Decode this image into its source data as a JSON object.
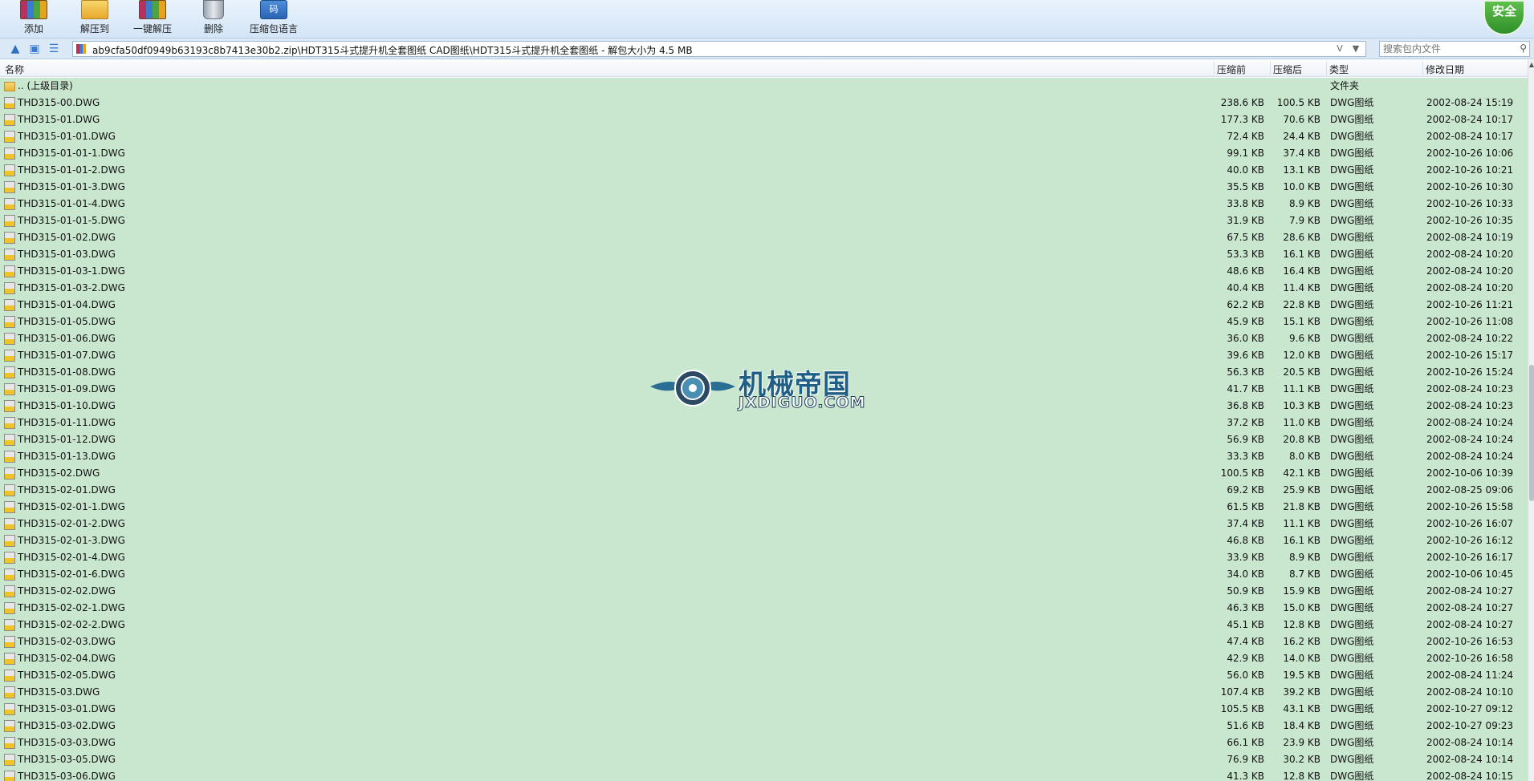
{
  "toolbar": {
    "buttons": [
      {
        "label": "添加",
        "icon": "add-archive-icon"
      },
      {
        "label": "解压到",
        "icon": "extract-to-icon"
      },
      {
        "label": "一键解压",
        "icon": "one-click-extract-icon"
      },
      {
        "label": "删除",
        "icon": "delete-icon"
      },
      {
        "label": "压缩包语言",
        "icon": "archive-language-icon"
      }
    ],
    "lang_icon_text": "码",
    "security_badge": "安全"
  },
  "address": {
    "path": "ab9cfa50df0949b63193c8b7413e30b2.zip\\HDT315斗式提升机全套图纸 CAD图纸\\HDT315斗式提升机全套图纸 - 解包大小为 4.5 MB",
    "dropdown_glyph": "V",
    "search_placeholder": "搜索包内文件"
  },
  "columns": {
    "name": "名称",
    "size": "压缩前",
    "packed": "压缩后",
    "type": "类型",
    "date": "修改日期"
  },
  "parent_row": {
    "name": ".. (上级目录)",
    "type": "文件夹"
  },
  "files": [
    {
      "name": "THD315-00.DWG",
      "size": "238.6 KB",
      "packed": "100.5 KB",
      "type": "DWG图纸",
      "date": "2002-08-24 15:19"
    },
    {
      "name": "THD315-01.DWG",
      "size": "177.3 KB",
      "packed": "70.6 KB",
      "type": "DWG图纸",
      "date": "2002-08-24 10:17"
    },
    {
      "name": "THD315-01-01.DWG",
      "size": "72.4 KB",
      "packed": "24.4 KB",
      "type": "DWG图纸",
      "date": "2002-08-24 10:17"
    },
    {
      "name": "THD315-01-01-1.DWG",
      "size": "99.1 KB",
      "packed": "37.4 KB",
      "type": "DWG图纸",
      "date": "2002-10-26 10:06"
    },
    {
      "name": "THD315-01-01-2.DWG",
      "size": "40.0 KB",
      "packed": "13.1 KB",
      "type": "DWG图纸",
      "date": "2002-10-26 10:21"
    },
    {
      "name": "THD315-01-01-3.DWG",
      "size": "35.5 KB",
      "packed": "10.0 KB",
      "type": "DWG图纸",
      "date": "2002-10-26 10:30"
    },
    {
      "name": "THD315-01-01-4.DWG",
      "size": "33.8 KB",
      "packed": "8.9 KB",
      "type": "DWG图纸",
      "date": "2002-10-26 10:33"
    },
    {
      "name": "THD315-01-01-5.DWG",
      "size": "31.9 KB",
      "packed": "7.9 KB",
      "type": "DWG图纸",
      "date": "2002-10-26 10:35"
    },
    {
      "name": "THD315-01-02.DWG",
      "size": "67.5 KB",
      "packed": "28.6 KB",
      "type": "DWG图纸",
      "date": "2002-08-24 10:19"
    },
    {
      "name": "THD315-01-03.DWG",
      "size": "53.3 KB",
      "packed": "16.1 KB",
      "type": "DWG图纸",
      "date": "2002-08-24 10:20"
    },
    {
      "name": "THD315-01-03-1.DWG",
      "size": "48.6 KB",
      "packed": "16.4 KB",
      "type": "DWG图纸",
      "date": "2002-08-24 10:20"
    },
    {
      "name": "THD315-01-03-2.DWG",
      "size": "40.4 KB",
      "packed": "11.4 KB",
      "type": "DWG图纸",
      "date": "2002-08-24 10:20"
    },
    {
      "name": "THD315-01-04.DWG",
      "size": "62.2 KB",
      "packed": "22.8 KB",
      "type": "DWG图纸",
      "date": "2002-10-26 11:21"
    },
    {
      "name": "THD315-01-05.DWG",
      "size": "45.9 KB",
      "packed": "15.1 KB",
      "type": "DWG图纸",
      "date": "2002-10-26 11:08"
    },
    {
      "name": "THD315-01-06.DWG",
      "size": "36.0 KB",
      "packed": "9.6 KB",
      "type": "DWG图纸",
      "date": "2002-08-24 10:22"
    },
    {
      "name": "THD315-01-07.DWG",
      "size": "39.6 KB",
      "packed": "12.0 KB",
      "type": "DWG图纸",
      "date": "2002-10-26 15:17"
    },
    {
      "name": "THD315-01-08.DWG",
      "size": "56.3 KB",
      "packed": "20.5 KB",
      "type": "DWG图纸",
      "date": "2002-10-26 15:24"
    },
    {
      "name": "THD315-01-09.DWG",
      "size": "41.7 KB",
      "packed": "11.1 KB",
      "type": "DWG图纸",
      "date": "2002-08-24 10:23"
    },
    {
      "name": "THD315-01-10.DWG",
      "size": "36.8 KB",
      "packed": "10.3 KB",
      "type": "DWG图纸",
      "date": "2002-08-24 10:23"
    },
    {
      "name": "THD315-01-11.DWG",
      "size": "37.2 KB",
      "packed": "11.0 KB",
      "type": "DWG图纸",
      "date": "2002-08-24 10:24"
    },
    {
      "name": "THD315-01-12.DWG",
      "size": "56.9 KB",
      "packed": "20.8 KB",
      "type": "DWG图纸",
      "date": "2002-08-24 10:24"
    },
    {
      "name": "THD315-01-13.DWG",
      "size": "33.3 KB",
      "packed": "8.0 KB",
      "type": "DWG图纸",
      "date": "2002-08-24 10:24"
    },
    {
      "name": "THD315-02.DWG",
      "size": "100.5 KB",
      "packed": "42.1 KB",
      "type": "DWG图纸",
      "date": "2002-10-06 10:39"
    },
    {
      "name": "THD315-02-01.DWG",
      "size": "69.2 KB",
      "packed": "25.9 KB",
      "type": "DWG图纸",
      "date": "2002-08-25 09:06"
    },
    {
      "name": "THD315-02-01-1.DWG",
      "size": "61.5 KB",
      "packed": "21.8 KB",
      "type": "DWG图纸",
      "date": "2002-10-26 15:58"
    },
    {
      "name": "THD315-02-01-2.DWG",
      "size": "37.4 KB",
      "packed": "11.1 KB",
      "type": "DWG图纸",
      "date": "2002-10-26 16:07"
    },
    {
      "name": "THD315-02-01-3.DWG",
      "size": "46.8 KB",
      "packed": "16.1 KB",
      "type": "DWG图纸",
      "date": "2002-10-26 16:12"
    },
    {
      "name": "THD315-02-01-4.DWG",
      "size": "33.9 KB",
      "packed": "8.9 KB",
      "type": "DWG图纸",
      "date": "2002-10-26 16:17"
    },
    {
      "name": "THD315-02-01-6.DWG",
      "size": "34.0 KB",
      "packed": "8.7 KB",
      "type": "DWG图纸",
      "date": "2002-10-06 10:45"
    },
    {
      "name": "THD315-02-02.DWG",
      "size": "50.9 KB",
      "packed": "15.9 KB",
      "type": "DWG图纸",
      "date": "2002-08-24 10:27"
    },
    {
      "name": "THD315-02-02-1.DWG",
      "size": "46.3 KB",
      "packed": "15.0 KB",
      "type": "DWG图纸",
      "date": "2002-08-24 10:27"
    },
    {
      "name": "THD315-02-02-2.DWG",
      "size": "45.1 KB",
      "packed": "12.8 KB",
      "type": "DWG图纸",
      "date": "2002-08-24 10:27"
    },
    {
      "name": "THD315-02-03.DWG",
      "size": "47.4 KB",
      "packed": "16.2 KB",
      "type": "DWG图纸",
      "date": "2002-10-26 16:53"
    },
    {
      "name": "THD315-02-04.DWG",
      "size": "42.9 KB",
      "packed": "14.0 KB",
      "type": "DWG图纸",
      "date": "2002-10-26 16:58"
    },
    {
      "name": "THD315-02-05.DWG",
      "size": "56.0 KB",
      "packed": "19.5 KB",
      "type": "DWG图纸",
      "date": "2002-08-24 11:24"
    },
    {
      "name": "THD315-03.DWG",
      "size": "107.4 KB",
      "packed": "39.2 KB",
      "type": "DWG图纸",
      "date": "2002-08-24 10:10"
    },
    {
      "name": "THD315-03-01.DWG",
      "size": "105.5 KB",
      "packed": "43.1 KB",
      "type": "DWG图纸",
      "date": "2002-10-27 09:12"
    },
    {
      "name": "THD315-03-02.DWG",
      "size": "51.6 KB",
      "packed": "18.4 KB",
      "type": "DWG图纸",
      "date": "2002-10-27 09:23"
    },
    {
      "name": "THD315-03-03.DWG",
      "size": "66.1 KB",
      "packed": "23.9 KB",
      "type": "DWG图纸",
      "date": "2002-08-24 10:14"
    },
    {
      "name": "THD315-03-05.DWG",
      "size": "76.9 KB",
      "packed": "30.2 KB",
      "type": "DWG图纸",
      "date": "2002-08-24 10:14"
    },
    {
      "name": "THD315-03-06.DWG",
      "size": "41.3 KB",
      "packed": "12.8 KB",
      "type": "DWG图纸",
      "date": "2002-08-24 10:15"
    }
  ],
  "watermark": {
    "title": "机械帝国",
    "subtitle": "JXDIGUO.COM"
  },
  "colors": {
    "list_background": "#c9e6cf",
    "toolbar_background": "#d3e5f7",
    "accent": "#2f6fc0"
  }
}
